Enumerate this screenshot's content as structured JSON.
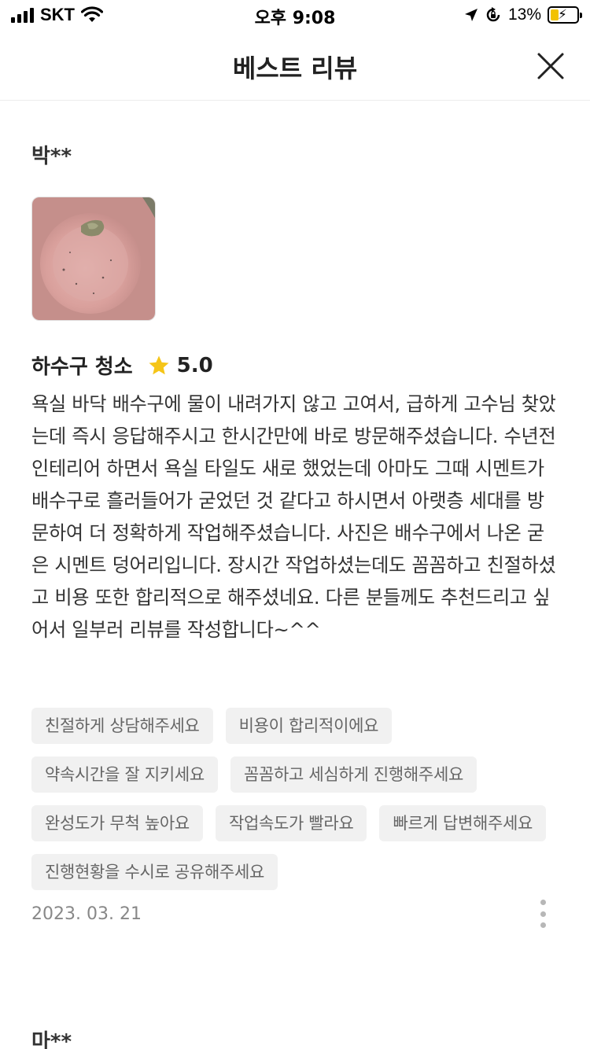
{
  "status_bar": {
    "carrier": "SKT",
    "time": "오후 9:08",
    "battery_percent": "13%"
  },
  "header": {
    "title": "베스트 리뷰",
    "close_icon": "close-icon"
  },
  "reviews": [
    {
      "reviewer": "박**",
      "photo": "drain-cement-photo",
      "service": "하수구 청소",
      "rating": "5.0",
      "rating_icon": "star-icon",
      "body": "욕실 바닥 배수구에 물이 내려가지 않고 고여서, 급하게 고수님 찾았는데 즉시 응답해주시고 한시간만에 바로 방문해주셨습니다.  수년전 인테리어 하면서 욕실 타일도 새로 했었는데 아마도 그때 시멘트가 배수구로 흘러들어가 굳었던 것 같다고 하시면서 아랫층 세대를 방문하여 더 정확하게 작업해주셨습니다. 사진은 배수구에서 나온 굳은 시멘트 덩어리입니다. 장시간 작업하셨는데도 꼼꼼하고 친절하셨고 비용 또한 합리적으로 해주셨네요. 다른 분들께도 추천드리고 싶어서 일부러 리뷰를 작성합니다~^^",
      "tags": [
        "친절하게 상담해주세요",
        "비용이 합리적이에요",
        "약속시간을 잘 지키세요",
        "꼼꼼하고 세심하게 진행해주세요",
        "완성도가 무척 높아요",
        "작업속도가 빨라요",
        "빠르게 답변해주세요",
        "진행현황을 수시로 공유해주세요"
      ],
      "date": "2023. 03. 21"
    },
    {
      "reviewer": "마**"
    }
  ],
  "colors": {
    "star": "#F5C518",
    "tag_bg": "#F1F1F1",
    "date_text": "#888888"
  }
}
